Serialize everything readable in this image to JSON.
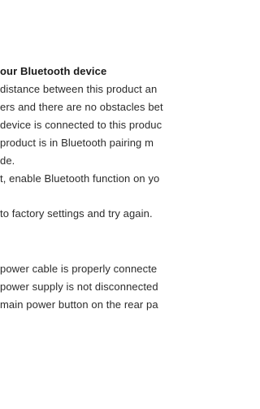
{
  "document": {
    "heading": "our Bluetooth device",
    "lines": [
      "distance between this product an",
      "ers and there are no obstacles bet",
      "device is connected to this produc",
      " product is in Bluetooth pairing m",
      "de.",
      "t, enable Bluetooth function on yo",
      "to factory settings and try again.",
      "power cable is properly connecte",
      "power supply is not disconnected",
      "main power button on the rear pa"
    ]
  }
}
